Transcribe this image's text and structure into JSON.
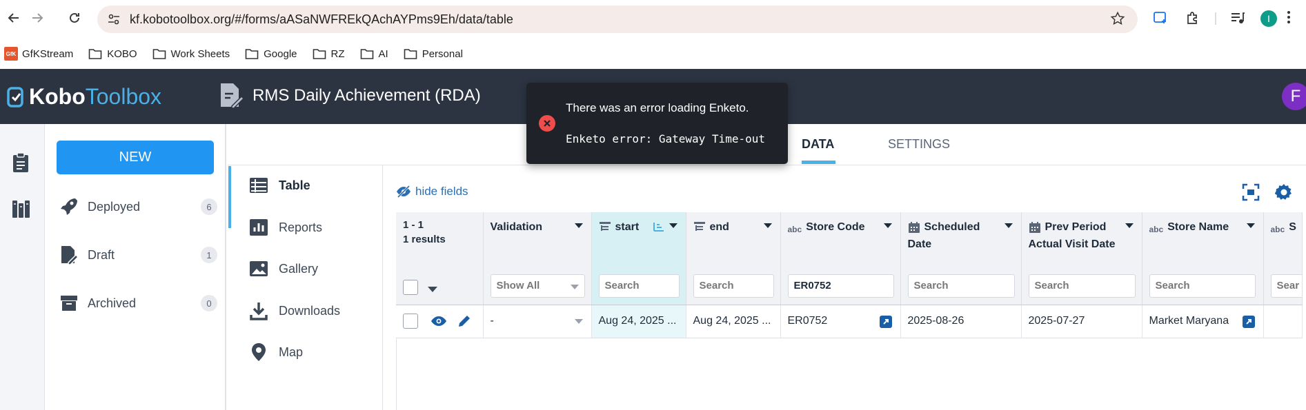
{
  "browser": {
    "url": "kf.kobotoolbox.org/#/forms/aASaNWFREkQAchAYPms9Eh/data/table",
    "profile_initial": "I",
    "bookmarks": [
      {
        "label": "GfKStream",
        "icon": "gfk-icon"
      },
      {
        "label": "KOBO",
        "icon": "folder-icon"
      },
      {
        "label": "Work Sheets",
        "icon": "folder-icon"
      },
      {
        "label": "Google",
        "icon": "folder-icon"
      },
      {
        "label": "RZ",
        "icon": "folder-icon"
      },
      {
        "label": "AI",
        "icon": "folder-icon"
      },
      {
        "label": "Personal",
        "icon": "folder-icon"
      }
    ],
    "gfk_badge": "GfK"
  },
  "header": {
    "logo_kobo": "Kobo",
    "logo_toolbox": "Toolbox",
    "form_title": "RMS Daily Achievement (RDA)",
    "avatar_initial": "F"
  },
  "sidebar": {
    "new_label": "NEW",
    "items": [
      {
        "label": "Deployed",
        "count": "6"
      },
      {
        "label": "Draft",
        "count": "1"
      },
      {
        "label": "Archived",
        "count": "0"
      }
    ]
  },
  "tabs": [
    {
      "label": "DATA",
      "active": true
    },
    {
      "label": "SETTINGS",
      "active": false
    }
  ],
  "subnav": [
    {
      "label": "Table",
      "active": true
    },
    {
      "label": "Reports",
      "active": false
    },
    {
      "label": "Gallery",
      "active": false
    },
    {
      "label": "Downloads",
      "active": false
    },
    {
      "label": "Map",
      "active": false
    }
  ],
  "toolbar": {
    "hide_fields": "hide fields"
  },
  "table": {
    "range": "1 - 1",
    "results": "1 results",
    "columns": {
      "validation": {
        "title": "Validation",
        "filter": "Show All"
      },
      "start": {
        "title": "start",
        "filter": "Search"
      },
      "end": {
        "title": "end",
        "filter": "Search"
      },
      "store_code": {
        "title": "Store Code",
        "filter": "ER0752",
        "type_label": "abc"
      },
      "scheduled": {
        "title_line1": "Scheduled",
        "title_line2": "Date",
        "filter": "Search"
      },
      "prev_period": {
        "title_line1": "Prev Period",
        "title_line2": "Actual Visit Date",
        "filter": "Search"
      },
      "store_name": {
        "title": "Store Name",
        "filter": "Search",
        "type_label": "abc"
      },
      "extra": {
        "title": "S",
        "filter": "Sear",
        "type_label": "abc"
      }
    },
    "row": {
      "validation": "-",
      "start": "Aug 24, 2025 ...",
      "end": "Aug 24, 2025 ...",
      "store_code": "ER0752",
      "scheduled": "2025-08-26",
      "prev_period": "2025-07-27",
      "store_name": "Market Maryana"
    }
  },
  "toast": {
    "title": "There was an error loading Enketo.",
    "message": "Enketo error: Gateway Time-out"
  },
  "colors": {
    "header_bg": "#2c3442",
    "accent_blue": "#2095f2",
    "toolbox_blue": "#4ab0e6",
    "toast_bg": "#1f2329",
    "error_red": "#ef4c4c",
    "avatar_purple": "#7d2fc5"
  }
}
